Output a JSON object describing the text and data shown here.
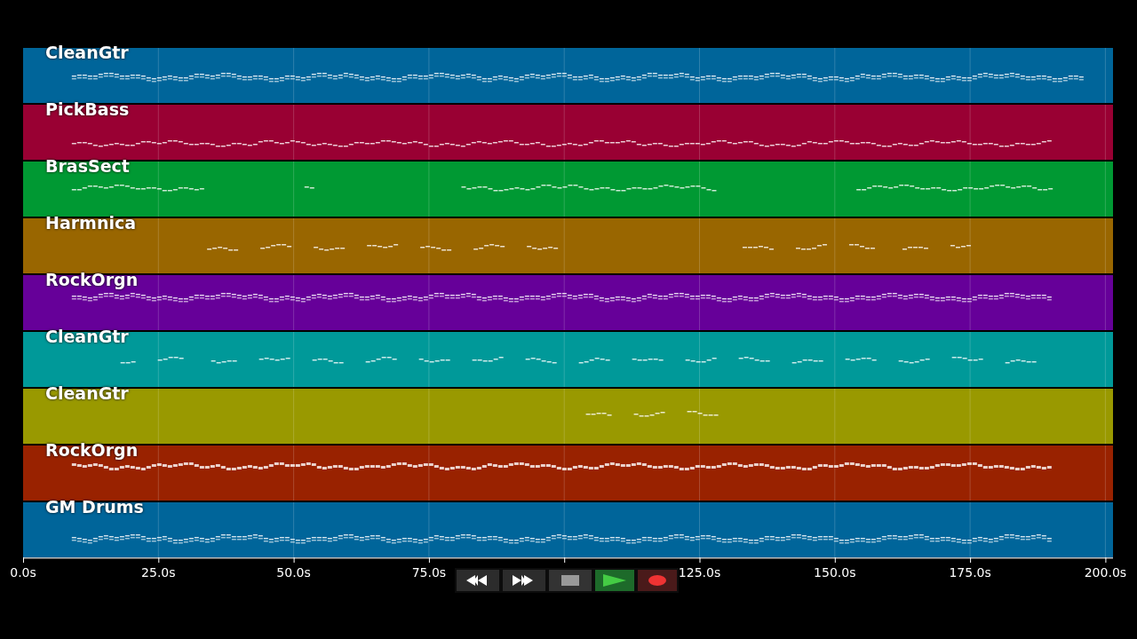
{
  "tracks": [
    {
      "name": "CleanGtr",
      "color": "#00659a"
    },
    {
      "name": "PickBass",
      "color": "#990033"
    },
    {
      "name": "BrasSect",
      "color": "#009933"
    },
    {
      "name": "Harmnica",
      "color": "#996600"
    },
    {
      "name": "RockOrgn",
      "color": "#660099"
    },
    {
      "name": "CleanGtr",
      "color": "#009999"
    },
    {
      "name": "CleanGtr",
      "color": "#999900"
    },
    {
      "name": "RockOrgn",
      "color": "#992200"
    },
    {
      "name": "GM Drums",
      "color": "#00659a"
    }
  ],
  "time_axis": {
    "tick_labels": [
      "0.0s",
      "25.0s",
      "50.0s",
      "75.0s",
      "125.0s",
      "150.0s",
      "175.0s",
      "200.0s"
    ]
  },
  "transport": [
    {
      "kind": "rewind"
    },
    {
      "kind": "forward"
    },
    {
      "kind": "stop"
    },
    {
      "kind": "play"
    },
    {
      "kind": "record"
    }
  ]
}
